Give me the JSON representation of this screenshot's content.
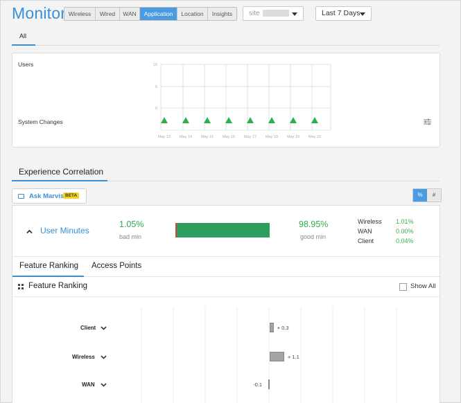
{
  "header": {
    "title": "Monitor",
    "segments": [
      "Wireless",
      "Wired",
      "WAN",
      "Application",
      "Location",
      "Insights"
    ],
    "active_segment": "Application",
    "site_dropdown": "site",
    "date_dropdown": "Last 7 Days"
  },
  "tabs": {
    "all": "All"
  },
  "chart": {
    "users_label": "Users",
    "system_changes_label": "System Changes",
    "y_ticks": [
      "10",
      "5",
      "0"
    ],
    "x_labels": [
      "May 13",
      "May 14",
      "May 15",
      "May 16",
      "May 17",
      "May 18",
      "May 19",
      "May 20"
    ]
  },
  "experience": {
    "title": "Experience Correlation",
    "ask_marvis": "Ask Marvis",
    "beta": "BETA",
    "toggle": [
      "%",
      "#"
    ],
    "toggle_active": "%",
    "sle_name": "User Minutes",
    "bad_pct": "1.05%",
    "bad_label": "bad min",
    "good_pct": "98.95%",
    "good_label": "good min",
    "bad_fraction": 0.0105,
    "breakdown": [
      {
        "name": "Wireless",
        "value": "1.01%"
      },
      {
        "name": "WAN",
        "value": "0.00%"
      },
      {
        "name": "Client",
        "value": "0.04%"
      }
    ],
    "colors": {
      "good": "#2e9e5e",
      "bad": "#d63f3f",
      "accent": "#3b8fd6"
    }
  },
  "feature_tabs": [
    "Feature Ranking",
    "Access Points"
  ],
  "feature_ranking": {
    "title": "Feature Ranking",
    "show_all": "Show All",
    "rows": [
      {
        "name": "Client",
        "value": 0.3,
        "label": "+ 0.3"
      },
      {
        "name": "Wireless",
        "value": 1.1,
        "label": "+ 1.1"
      },
      {
        "name": "WAN",
        "value": -0.1,
        "label": "-0.1"
      }
    ]
  }
}
